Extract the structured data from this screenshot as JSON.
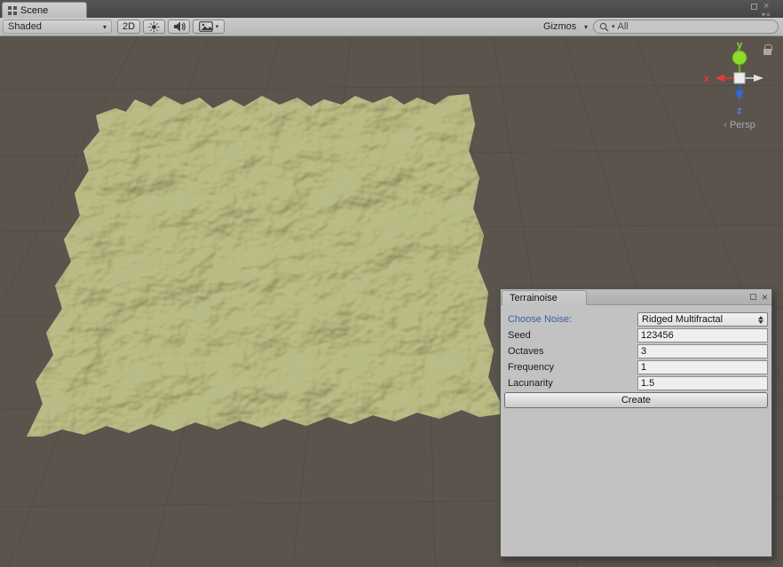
{
  "window": {
    "tab_title": "Scene"
  },
  "icons": {
    "dropdown_arrow": "▾",
    "close": "×",
    "menu": "≡"
  },
  "toolbar": {
    "shading_mode": "Shaded",
    "toggle_2d": "2D",
    "gizmos": "Gizmos",
    "search_value": "All"
  },
  "viewport": {
    "axis": {
      "x": "x",
      "y": "y",
      "z": "z"
    },
    "projection": "Persp"
  },
  "panel": {
    "tab_title": "Terrainoise",
    "noise": {
      "label": "Choose Noise:",
      "value": "Ridged Multifractal"
    },
    "fields": [
      {
        "label": "Seed",
        "value": "123456"
      },
      {
        "label": "Octaves",
        "value": "3"
      },
      {
        "label": "Frequency",
        "value": "1"
      },
      {
        "label": "Lacunarity",
        "value": "1.5"
      }
    ],
    "create_button": "Create"
  },
  "colors": {
    "viewport_bg": "#5a544d",
    "terrain_base": "#b9bc8a",
    "accent_blue": "#3a5fa5",
    "panel_bg": "#c2c2c2"
  }
}
